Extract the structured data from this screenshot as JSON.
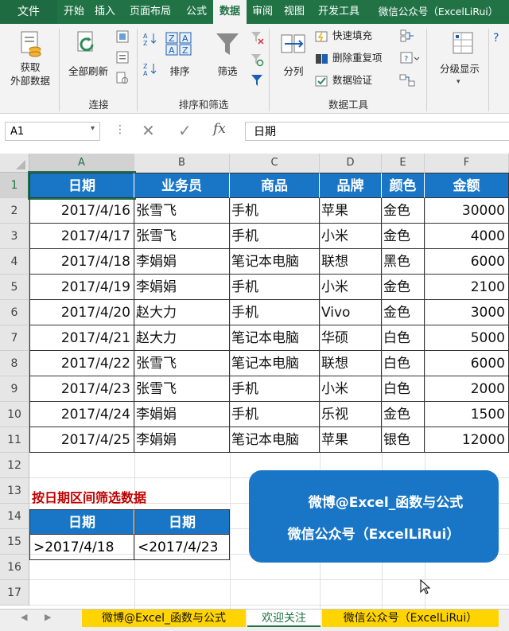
{
  "menu": {
    "file": "文件",
    "tabs": [
      "开始",
      "插入",
      "页面布局",
      "公式",
      "数据",
      "审阅",
      "视图",
      "开发工具",
      "微信公众号（ExcelLiRui）"
    ],
    "active_index": 4
  },
  "ribbon": {
    "get_external": "获取\n外部数据",
    "refresh_all": "全部刷新",
    "group_connect": "连接",
    "sort": "排序",
    "filter": "筛选",
    "group_sort_filter": "排序和筛选",
    "text_to_columns": "分列",
    "flash_fill": "快速填充",
    "remove_dup": "删除重复项",
    "data_validation": "数据验证",
    "group_data_tools": "数据工具",
    "outline": "分级显示"
  },
  "formula_bar": {
    "name_box": "A1",
    "fx": "fx",
    "value": "日期"
  },
  "columns": [
    "A",
    "B",
    "C",
    "D",
    "E",
    "F"
  ],
  "rows": [
    "1",
    "2",
    "3",
    "4",
    "5",
    "6",
    "7",
    "8",
    "9",
    "10",
    "11",
    "12",
    "13",
    "14",
    "15",
    "16",
    "17"
  ],
  "table": {
    "headers": [
      "日期",
      "业务员",
      "商品",
      "品牌",
      "颜色",
      "金额"
    ],
    "rows": [
      [
        "2017/4/16",
        "张雪飞",
        "手机",
        "苹果",
        "金色",
        "30000"
      ],
      [
        "2017/4/17",
        "张雪飞",
        "手机",
        "小米",
        "金色",
        "4000"
      ],
      [
        "2017/4/18",
        "李娟娟",
        "笔记本电脑",
        "联想",
        "黑色",
        "6000"
      ],
      [
        "2017/4/19",
        "李娟娟",
        "手机",
        "小米",
        "金色",
        "2100"
      ],
      [
        "2017/4/20",
        "赵大力",
        "手机",
        "Vivo",
        "金色",
        "3000"
      ],
      [
        "2017/4/21",
        "赵大力",
        "笔记本电脑",
        "华硕",
        "白色",
        "5000"
      ],
      [
        "2017/4/22",
        "张雪飞",
        "笔记本电脑",
        "联想",
        "白色",
        "6000"
      ],
      [
        "2017/4/23",
        "张雪飞",
        "手机",
        "小米",
        "白色",
        "2000"
      ],
      [
        "2017/4/24",
        "李娟娟",
        "手机",
        "乐视",
        "金色",
        "1500"
      ],
      [
        "2017/4/25",
        "李娟娟",
        "笔记本电脑",
        "苹果",
        "银色",
        "12000"
      ]
    ]
  },
  "criteria": {
    "title": "按日期区间筛选数据",
    "headers": [
      "日期",
      "日期"
    ],
    "values": [
      ">2017/4/18",
      "<2017/4/23"
    ]
  },
  "banner": {
    "line1": "微博@Excel_函数与公式",
    "line2": "微信公众号（ExcelLiRui）"
  },
  "sheet_tabs": [
    "微博@Excel_函数与公式",
    "欢迎关注",
    "微信公众号（ExcelLiRui）"
  ],
  "colors": {
    "excel_green": "#217346",
    "header_blue": "#1976c7",
    "title_red": "#c00000",
    "tab_yellow": "#ffd400"
  }
}
